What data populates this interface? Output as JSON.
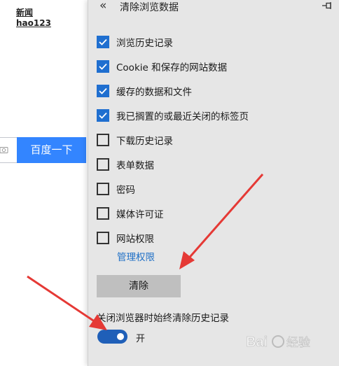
{
  "background_page": {
    "links": [
      "新闻",
      "hao123"
    ],
    "search_button_label": "百度一下"
  },
  "panel": {
    "title": "清除浏览数据",
    "options": [
      {
        "label": "浏览历史记录",
        "checked": true
      },
      {
        "label": "Cookie 和保存的网站数据",
        "checked": true
      },
      {
        "label": "缓存的数据和文件",
        "checked": true
      },
      {
        "label": "我已搁置的或最近关闭的标签页",
        "checked": true
      },
      {
        "label": "下载历史记录",
        "checked": false
      },
      {
        "label": "表单数据",
        "checked": false
      },
      {
        "label": "密码",
        "checked": false
      },
      {
        "label": "媒体许可证",
        "checked": false
      },
      {
        "label": "网站权限",
        "checked": false
      }
    ],
    "manage_link": "管理权限",
    "clear_button_label": "清除",
    "always_clear_label": "关闭浏览器时始终清除历史记录",
    "toggle_state_label": "开",
    "toggle_on": true
  },
  "colors": {
    "accent": "#1f6fd0",
    "search_button": "#3385ff",
    "panel_bg": "#e6e6e6",
    "annotation_arrow": "#e53935"
  },
  "watermark_text": "Bai 经验"
}
